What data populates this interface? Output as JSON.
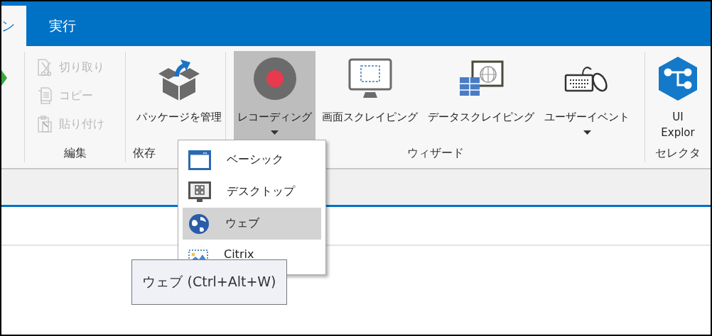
{
  "tabs": [
    {
      "label": "ン",
      "selected": true
    },
    {
      "label": "実行",
      "selected": false
    }
  ],
  "ribbon": {
    "groups": [
      {
        "kind": "small",
        "label": "編集",
        "items": [
          {
            "label": "切り取り",
            "kind": "cut",
            "disabled": true
          },
          {
            "label": "コピー",
            "kind": "copy",
            "disabled": true
          },
          {
            "label": "貼り付け",
            "kind": "paste",
            "disabled": true
          }
        ]
      },
      {
        "kind": "large",
        "label": "依存",
        "buttons": [
          {
            "label": "パッケージを管理",
            "kind": "package",
            "selected": false,
            "dropdown": false
          }
        ]
      },
      {
        "kind": "large",
        "label": "ウィザード",
        "buttons": [
          {
            "label": "レコーディング",
            "kind": "record",
            "selected": true,
            "dropdown": true
          },
          {
            "label": "画面スクレイピング",
            "kind": "screen",
            "selected": false,
            "dropdown": false
          },
          {
            "label": "データスクレイピング",
            "kind": "data",
            "selected": false,
            "dropdown": false
          },
          {
            "label": "ユーザーイベント",
            "kind": "events",
            "selected": false,
            "dropdown": true
          }
        ]
      },
      {
        "kind": "large",
        "label": "セレクタ",
        "buttons": [
          {
            "label": "UI\nExplor",
            "kind": "explorer",
            "selected": false,
            "dropdown": false
          }
        ]
      }
    ]
  },
  "menu": {
    "items": [
      {
        "label": "ベーシック",
        "kind": "basic",
        "selected": false
      },
      {
        "label": "デスクトップ",
        "kind": "desktop",
        "selected": false
      },
      {
        "label": "ウェブ",
        "kind": "web",
        "selected": true
      },
      {
        "label": "Citrix",
        "kind": "citrix",
        "selected": false
      }
    ]
  },
  "tooltip": {
    "text": "ウェブ (Ctrl+Alt+W)"
  }
}
